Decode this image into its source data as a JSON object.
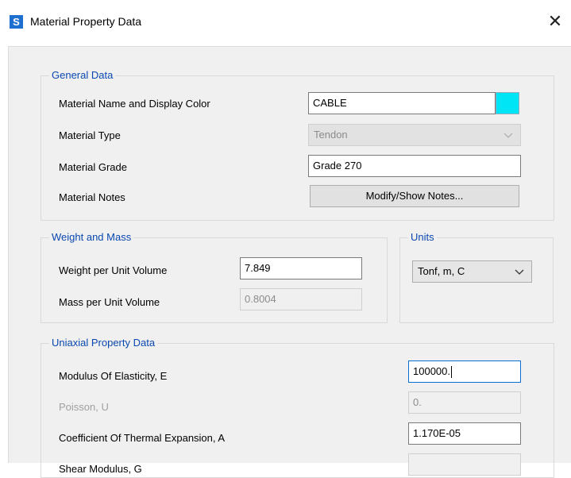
{
  "window": {
    "title": "Material Property Data",
    "app_icon_letter": "S",
    "close_glyph": "✕"
  },
  "general_data": {
    "group_title": "General Data",
    "material_name_label": "Material Name and Display Color",
    "material_name_value": "CABLE",
    "display_color": "#00e5f5",
    "material_type_label": "Material Type",
    "material_type_value": "Tendon",
    "material_grade_label": "Material Grade",
    "material_grade_value": "Grade 270",
    "material_notes_label": "Material Notes",
    "modify_notes_button": "Modify/Show Notes..."
  },
  "weight_and_mass": {
    "group_title": "Weight and Mass",
    "weight_label": "Weight per Unit Volume",
    "weight_value": "7.849",
    "mass_label": "Mass per Unit Volume",
    "mass_value": "0.8004"
  },
  "units": {
    "group_title": "Units",
    "selected": "Tonf, m, C"
  },
  "uniaxial": {
    "group_title": "Uniaxial Property Data",
    "modulus_label": "Modulus Of Elasticity,  E",
    "modulus_value": "100000.",
    "poisson_label": "Poisson,  U",
    "poisson_value": "0.",
    "thermal_label": "Coefficient Of Thermal Expansion,  A",
    "thermal_value": "1.170E-05",
    "shear_label": "Shear Modulus,  G",
    "shear_value": ""
  },
  "colors": {
    "accent_title": "#0a48b0",
    "focus_border": "#0a6ed4"
  }
}
